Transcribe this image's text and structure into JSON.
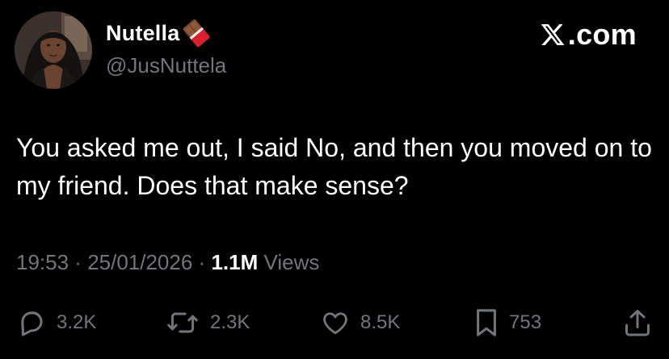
{
  "app": {
    "brand_text": ".com",
    "brand_icon": "x-logo-icon"
  },
  "author": {
    "display_name": "Nutella",
    "name_emoji": "chocolate-bar-emoji",
    "handle": "@JusNuttela",
    "avatar": "profile-photo"
  },
  "tweet": {
    "text": "You asked me out, I said No, and then you moved on to my friend. Does that make sense?",
    "time": "19:53",
    "separator1": " · ",
    "date": "25/01/2026",
    "separator2": " · ",
    "views_count": "1.1M",
    "views_label": " Views"
  },
  "actions": {
    "replies": {
      "icon": "reply-icon",
      "count": "3.2K"
    },
    "reposts": {
      "icon": "repost-icon",
      "count": "2.3K"
    },
    "likes": {
      "icon": "heart-icon",
      "count": "8.5K"
    },
    "bookmarks": {
      "icon": "bookmark-icon",
      "count": "753"
    },
    "share": {
      "icon": "share-icon"
    }
  },
  "colors": {
    "background": "#000000",
    "primary_text": "#ffffff",
    "secondary_text": "#71767b"
  }
}
